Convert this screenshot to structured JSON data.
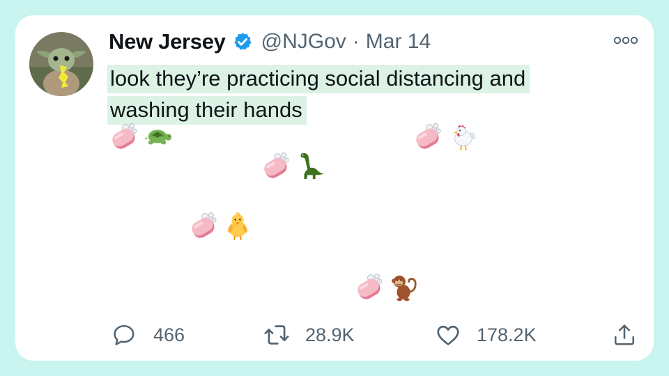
{
  "tweet": {
    "author_name": "New Jersey",
    "verified": true,
    "handle": "@NJGov",
    "separator": "·",
    "date": "Mar 14",
    "text_line1": "look they’re practicing social distancing and",
    "text_line2": "washing their hands",
    "emoji_pairs": [
      {
        "soap": "soap-icon",
        "animal": "turtle-icon"
      },
      {
        "soap": "soap-icon",
        "animal": "rooster-icon"
      },
      {
        "soap": "soap-icon",
        "animal": "sauropod-icon"
      },
      {
        "soap": "soap-icon",
        "animal": "chick-icon"
      },
      {
        "soap": "soap-icon",
        "animal": "monkey-icon"
      }
    ]
  },
  "actions": {
    "reply_count": "466",
    "retweet_count": "28.9K",
    "like_count": "178.2K"
  },
  "colors": {
    "background": "#c9f4ef",
    "card": "#ffffff",
    "highlight": "#dcf2e4",
    "verified_blue": "#1d9bf0",
    "secondary_text": "#536471",
    "primary_text": "#0f1419"
  }
}
